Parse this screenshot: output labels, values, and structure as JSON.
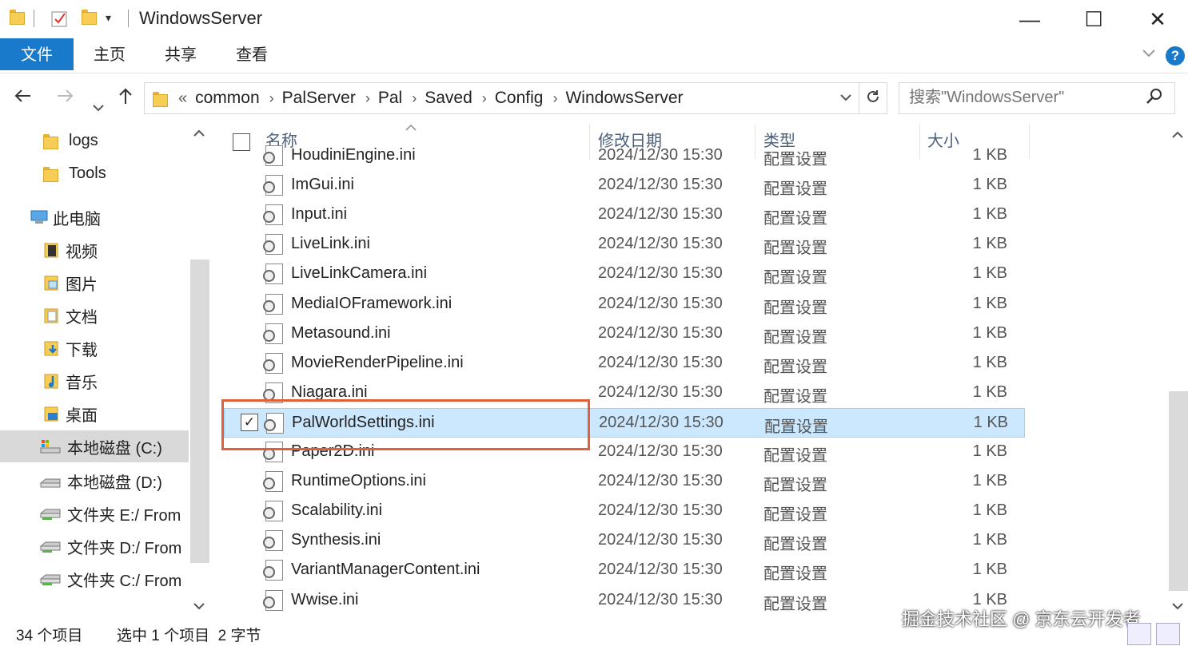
{
  "window": {
    "title": "WindowsServer",
    "minimize": "—",
    "maximize": "☐",
    "close": "✕"
  },
  "ribbon": {
    "tabs": [
      "文件",
      "主页",
      "共享",
      "查看"
    ],
    "help": "?"
  },
  "address_bar": {
    "overflow": "«",
    "segments": [
      "common",
      "PalServer",
      "Pal",
      "Saved",
      "Config",
      "WindowsServer"
    ]
  },
  "search": {
    "placeholder": "搜索\"WindowsServer\""
  },
  "sidebar": {
    "items": [
      {
        "label": "logs",
        "icon": "folder-icon"
      },
      {
        "label": "Tools",
        "icon": "folder-icon"
      },
      {
        "label": "此电脑",
        "icon": "computer-icon"
      },
      {
        "label": "视频",
        "icon": "video-folder-icon"
      },
      {
        "label": "图片",
        "icon": "pictures-folder-icon"
      },
      {
        "label": "文档",
        "icon": "documents-folder-icon"
      },
      {
        "label": "下载",
        "icon": "downloads-folder-icon"
      },
      {
        "label": "音乐",
        "icon": "music-folder-icon"
      },
      {
        "label": "桌面",
        "icon": "desktop-folder-icon"
      },
      {
        "label": "本地磁盘 (C:)",
        "icon": "drive-c-icon"
      },
      {
        "label": "本地磁盘 (D:)",
        "icon": "drive-icon"
      },
      {
        "label": "文件夹 E:/ From",
        "icon": "network-drive-icon"
      },
      {
        "label": "文件夹 D:/ From",
        "icon": "network-drive-icon"
      },
      {
        "label": "文件夹 C:/ From",
        "icon": "network-drive-icon"
      }
    ],
    "selected_index": 9
  },
  "columns": {
    "name": "名称",
    "date": "修改日期",
    "type": "类型",
    "size": "大小"
  },
  "files": [
    {
      "name": "HoudiniEngine.ini",
      "date": "2024/12/30 15:30",
      "type": "配置设置",
      "size": "1 KB"
    },
    {
      "name": "ImGui.ini",
      "date": "2024/12/30 15:30",
      "type": "配置设置",
      "size": "1 KB"
    },
    {
      "name": "Input.ini",
      "date": "2024/12/30 15:30",
      "type": "配置设置",
      "size": "1 KB"
    },
    {
      "name": "LiveLink.ini",
      "date": "2024/12/30 15:30",
      "type": "配置设置",
      "size": "1 KB"
    },
    {
      "name": "LiveLinkCamera.ini",
      "date": "2024/12/30 15:30",
      "type": "配置设置",
      "size": "1 KB"
    },
    {
      "name": "MediaIOFramework.ini",
      "date": "2024/12/30 15:30",
      "type": "配置设置",
      "size": "1 KB"
    },
    {
      "name": "Metasound.ini",
      "date": "2024/12/30 15:30",
      "type": "配置设置",
      "size": "1 KB"
    },
    {
      "name": "MovieRenderPipeline.ini",
      "date": "2024/12/30 15:30",
      "type": "配置设置",
      "size": "1 KB"
    },
    {
      "name": "Niagara.ini",
      "date": "2024/12/30 15:30",
      "type": "配置设置",
      "size": "1 KB"
    },
    {
      "name": "PalWorldSettings.ini",
      "date": "2024/12/30 15:30",
      "type": "配置设置",
      "size": "1 KB",
      "selected": true
    },
    {
      "name": "Paper2D.ini",
      "date": "2024/12/30 15:30",
      "type": "配置设置",
      "size": "1 KB"
    },
    {
      "name": "RuntimeOptions.ini",
      "date": "2024/12/30 15:30",
      "type": "配置设置",
      "size": "1 KB"
    },
    {
      "name": "Scalability.ini",
      "date": "2024/12/30 15:30",
      "type": "配置设置",
      "size": "1 KB"
    },
    {
      "name": "Synthesis.ini",
      "date": "2024/12/30 15:30",
      "type": "配置设置",
      "size": "1 KB"
    },
    {
      "name": "VariantManagerContent.ini",
      "date": "2024/12/30 15:30",
      "type": "配置设置",
      "size": "1 KB"
    },
    {
      "name": "Wwise.ini",
      "date": "2024/12/30 15:30",
      "type": "配置设置",
      "size": "1 KB"
    }
  ],
  "status": {
    "item_count": "34 个项目",
    "selection": "选中 1 个项目  2 字节"
  },
  "watermark": "掘金技术社区 @ 京东云开发者",
  "colors": {
    "accent": "#1979ca",
    "selection_bg": "#cce8ff",
    "highlight_box": "#e0603c"
  }
}
